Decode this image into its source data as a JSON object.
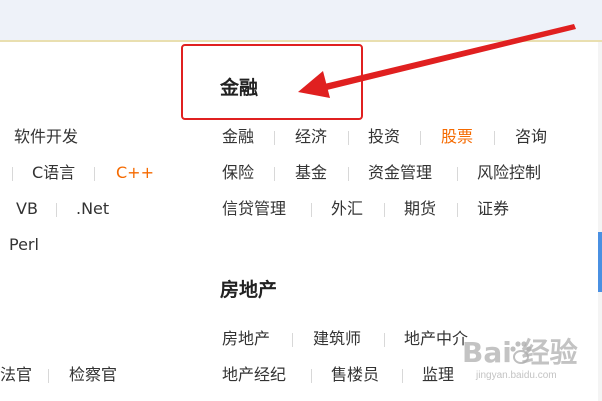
{
  "left_col": {
    "heading": "软件开发",
    "row2": [
      "C语言",
      "C++"
    ],
    "row3": [
      "VB",
      ".Net"
    ],
    "row4": [
      "Perl"
    ],
    "bottom": [
      "法官",
      "检察官"
    ]
  },
  "finance": {
    "heading": "金融",
    "rows": [
      [
        "金融",
        "经济",
        "投资",
        "股票",
        "咨询"
      ],
      [
        "保险",
        "基金",
        "资金管理",
        "风险控制"
      ],
      [
        "信贷管理",
        "外汇",
        "期货",
        "证券"
      ]
    ]
  },
  "realestate": {
    "heading": "房地产",
    "rows": [
      [
        "房地产",
        "建筑师",
        "地产中介"
      ],
      [
        "地产经纪",
        "售楼员",
        "监理"
      ]
    ]
  },
  "watermark": {
    "brand": "Bai 经验",
    "url": "jingyan.baidu.com"
  },
  "colors": {
    "highlight": "#f56a00",
    "annotation": "#e02020"
  }
}
